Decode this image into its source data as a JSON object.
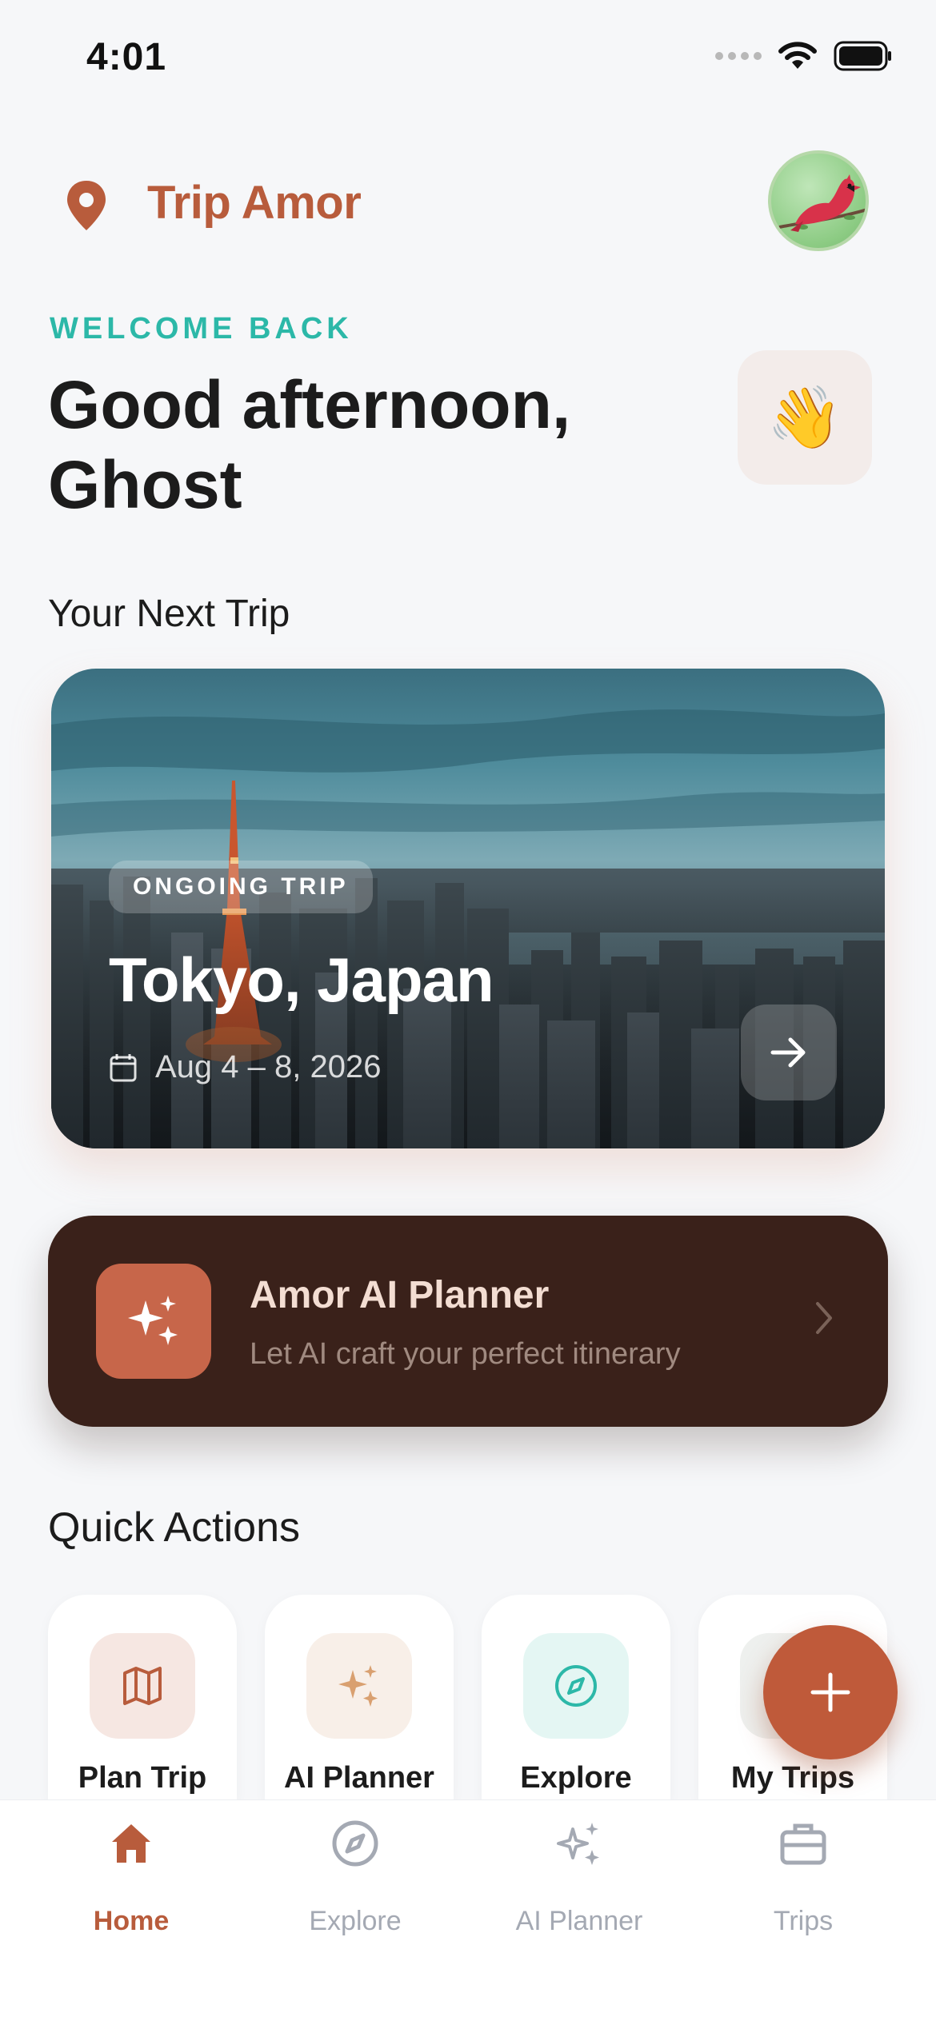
{
  "status_bar": {
    "time": "4:01"
  },
  "header": {
    "brand": "Trip Amor"
  },
  "greeting": {
    "eyebrow": "WELCOME BACK",
    "line1": "Good afternoon,",
    "line2": "Ghost",
    "emoji": "👋"
  },
  "next_trip": {
    "section_title": "Your Next Trip",
    "badge": "ONGOING TRIP",
    "city": "Tokyo, Japan",
    "dates": "Aug 4 – 8, 2026"
  },
  "ai_banner": {
    "title": "Amor AI Planner",
    "subtitle": "Let AI craft your perfect itinerary"
  },
  "quick_actions": {
    "section_title": "Quick Actions",
    "items": [
      {
        "label": "Plan Trip",
        "icon": "map-icon"
      },
      {
        "label": "AI Planner",
        "icon": "sparkles-icon"
      },
      {
        "label": "Explore",
        "icon": "compass-icon"
      },
      {
        "label": "My Trips",
        "icon": "suitcase-icon"
      }
    ]
  },
  "bottom_nav": {
    "items": [
      {
        "label": "Home",
        "icon": "home-icon",
        "active": true
      },
      {
        "label": "Explore",
        "icon": "compass-icon",
        "active": false
      },
      {
        "label": "AI Planner",
        "icon": "sparkles-icon",
        "active": false
      },
      {
        "label": "Trips",
        "icon": "briefcase-icon",
        "active": false
      }
    ]
  },
  "colors": {
    "brand": "#b85c3c",
    "accent_teal": "#2cb8a8",
    "banner_bg": "#3a211a",
    "background": "#f6f7f9"
  }
}
